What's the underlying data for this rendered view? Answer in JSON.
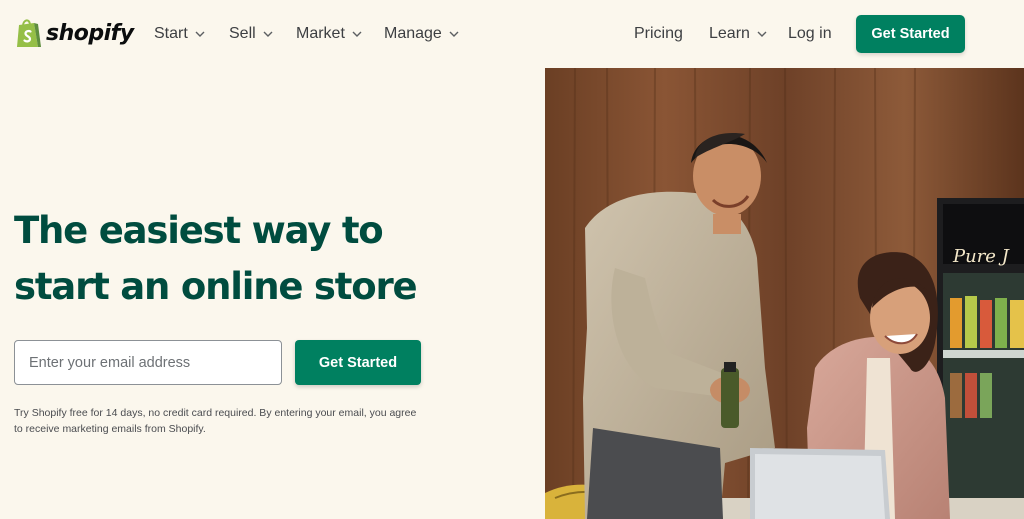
{
  "brand": {
    "name": "shopify",
    "color": "#008060",
    "dark_green": "#004c3f",
    "logo_icon": "shopping-bag-icon"
  },
  "nav": {
    "left_items": [
      {
        "label": "Start",
        "has_dropdown": true
      },
      {
        "label": "Sell",
        "has_dropdown": true
      },
      {
        "label": "Market",
        "has_dropdown": true
      },
      {
        "label": "Manage",
        "has_dropdown": true
      }
    ],
    "right_items": [
      {
        "label": "Pricing",
        "has_dropdown": false
      },
      {
        "label": "Learn",
        "has_dropdown": true
      },
      {
        "label": "Log in",
        "has_dropdown": false
      }
    ],
    "cta_label": "Get Started"
  },
  "hero": {
    "title_line1": "The easiest way to",
    "title_line2": "start an online store",
    "email_placeholder": "Enter your email address",
    "email_value": "",
    "cta_label": "Get Started",
    "disclaimer_line1": "Try Shopify free for 14 days, no credit card required. By entering your email, you agree",
    "disclaimer_line2": "to receive marketing emails from Shopify."
  },
  "photo": {
    "sign_text": "Pure J"
  }
}
